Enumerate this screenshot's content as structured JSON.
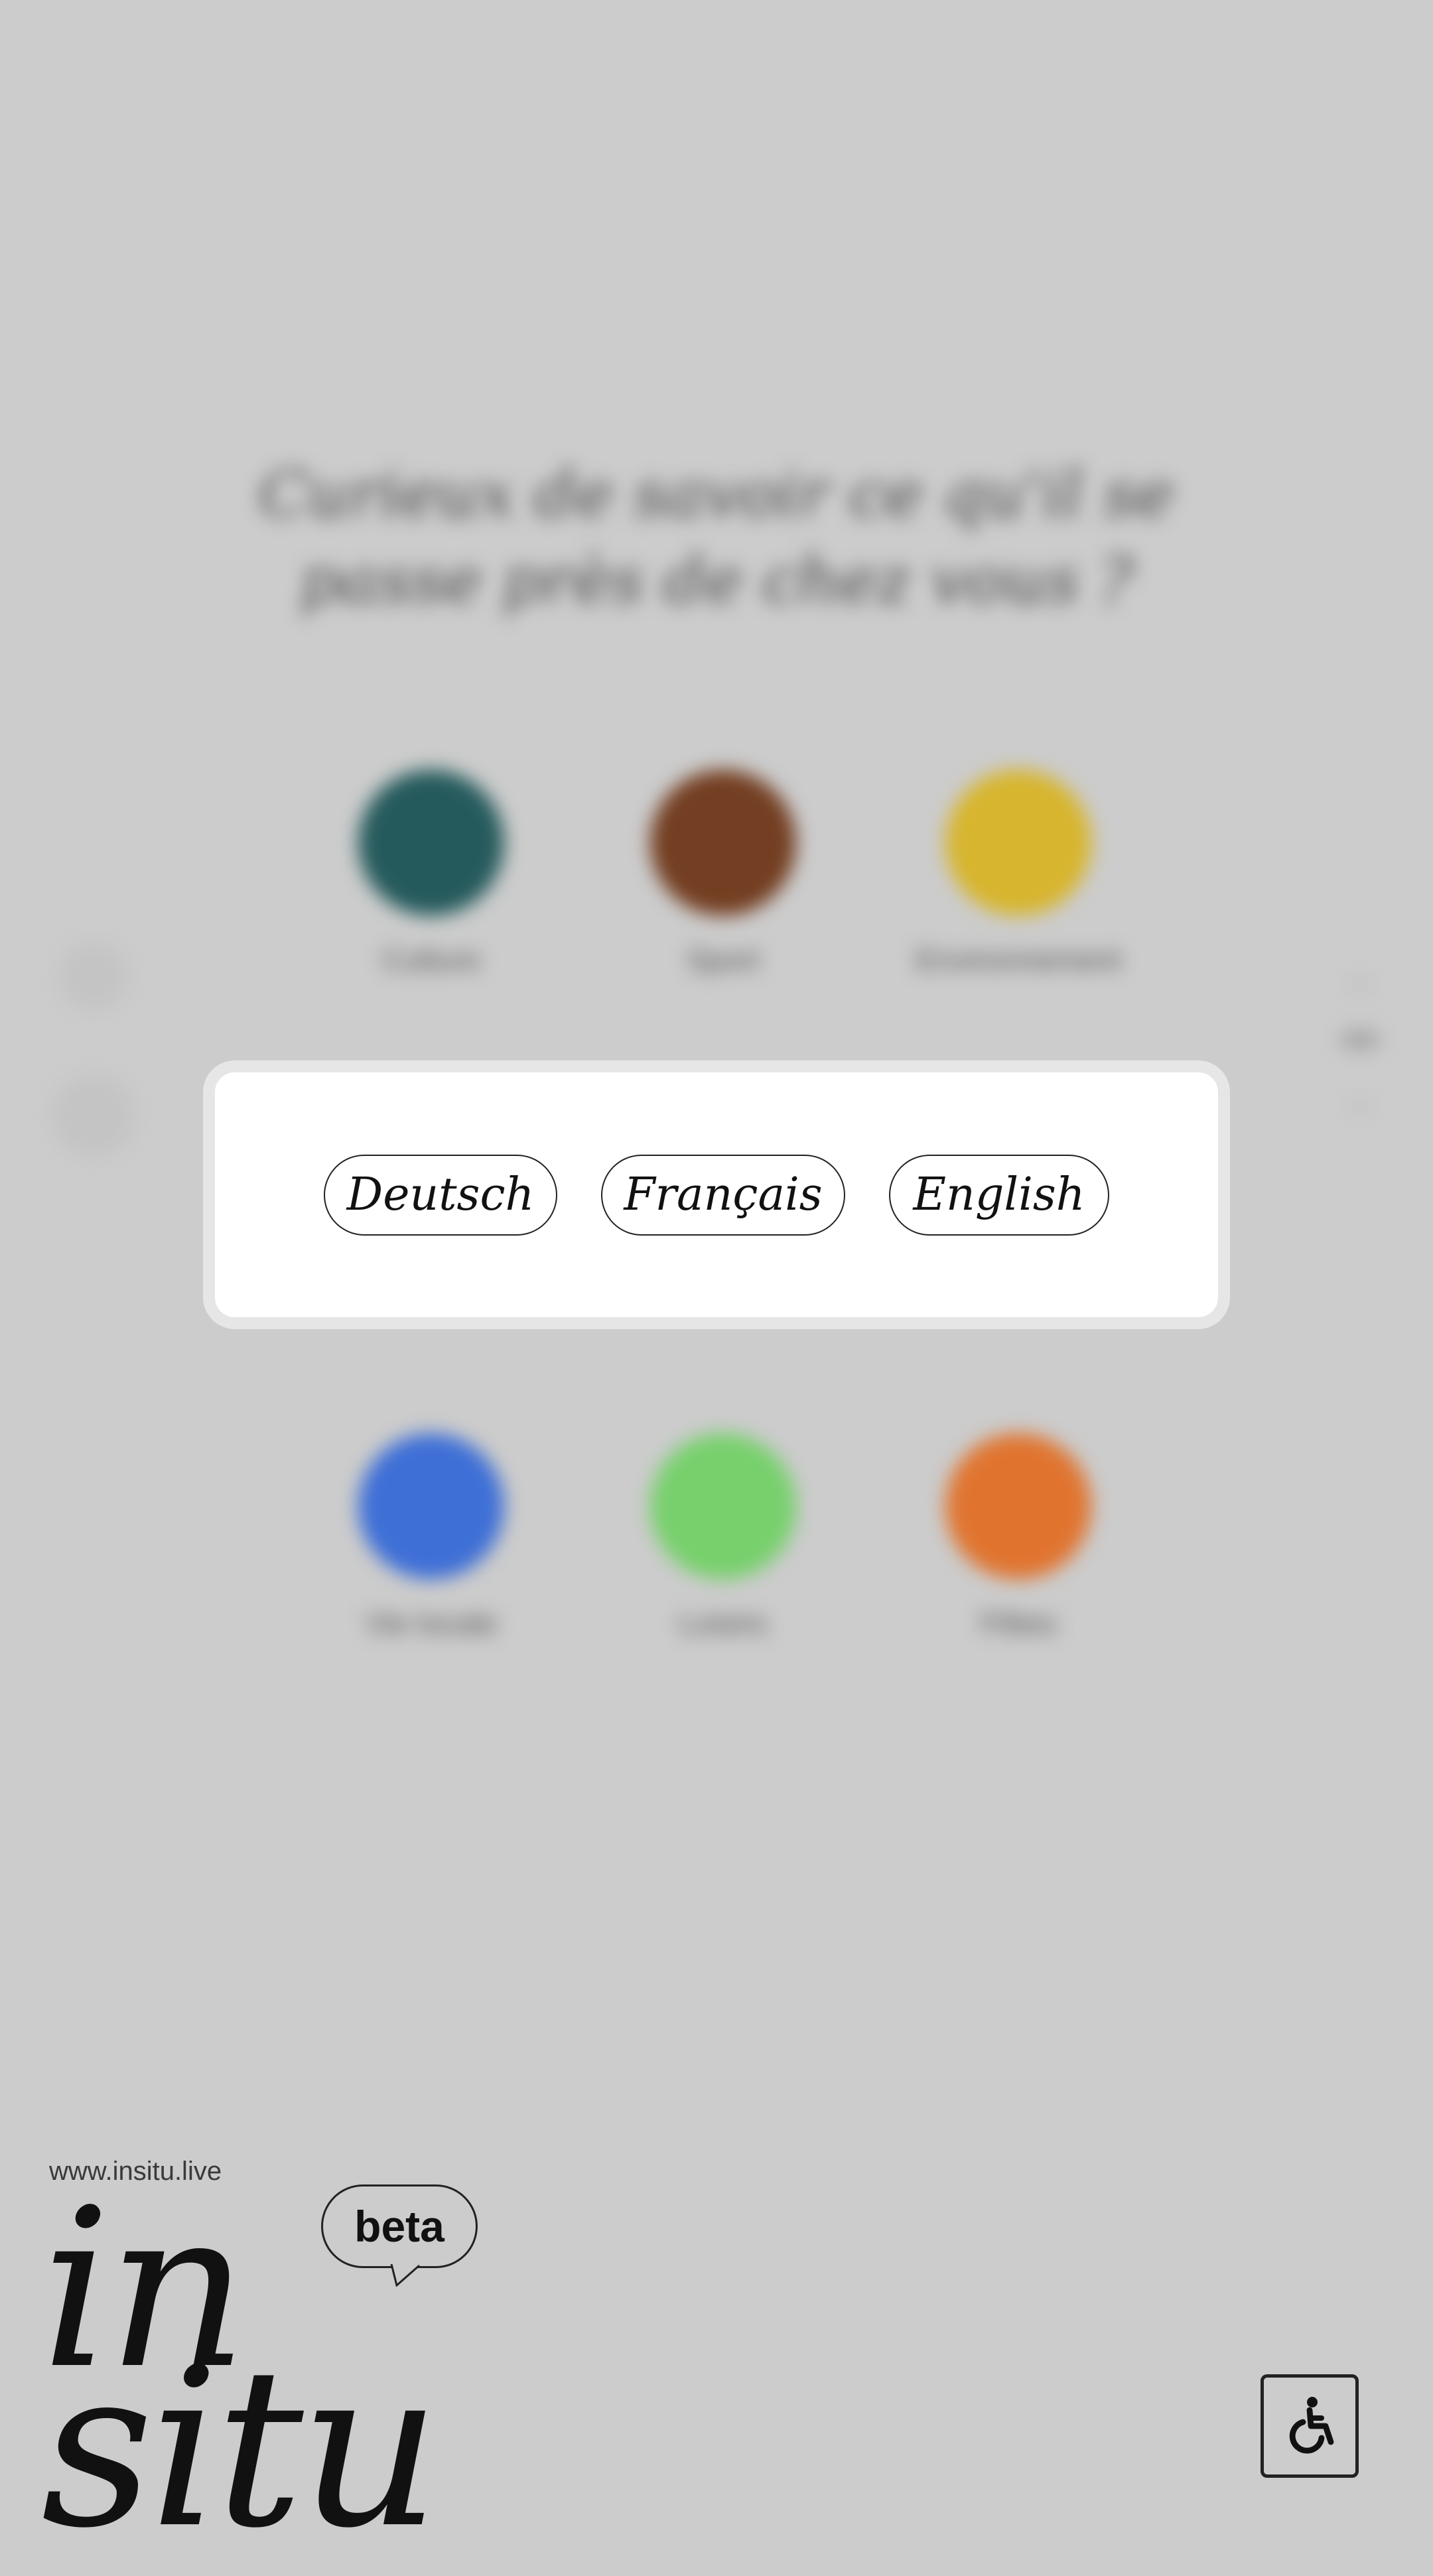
{
  "background": {
    "question": "Curieux de savoir ce qu'il se passe près de chez vous ?",
    "categories": [
      {
        "label": "Culture",
        "color": "#255a5c"
      },
      {
        "label": "Sport",
        "color": "#733e21"
      },
      {
        "label": "Environnement",
        "color": "#d7b52e"
      },
      {
        "label": "",
        "color": "#cccccc"
      },
      {
        "label": "",
        "color": "#cccccc"
      },
      {
        "label": "",
        "color": "#cccccc"
      },
      {
        "label": "Vie locale",
        "color": "#3e6fd6"
      },
      {
        "label": "Loisirs",
        "color": "#77d06c"
      },
      {
        "label": "Fêtes",
        "color": "#e0742f"
      }
    ]
  },
  "language_modal": {
    "buttons": [
      "Deutsch",
      "Français",
      "English"
    ]
  },
  "footer": {
    "url": "www.insitu.live",
    "logo_line1": "in",
    "logo_line2": "situ",
    "badge": "beta",
    "accessibility_icon": "wheelchair-icon"
  }
}
